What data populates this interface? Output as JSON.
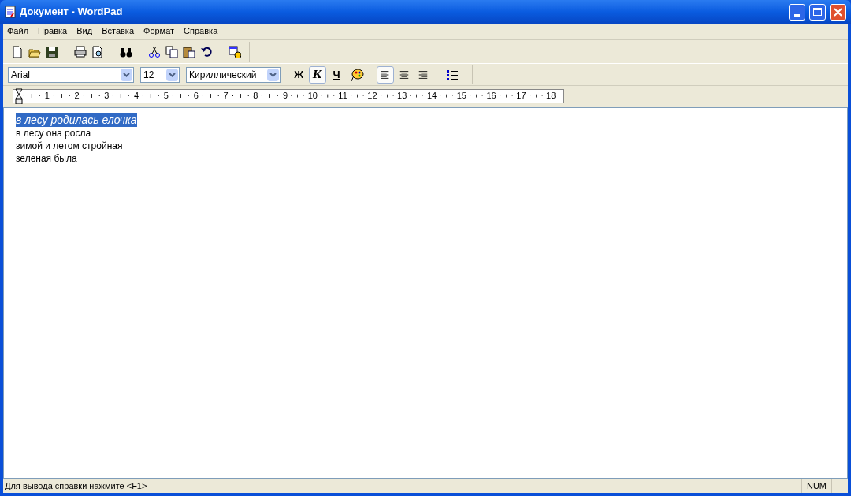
{
  "window": {
    "title": "Документ - WordPad"
  },
  "menu": [
    "Файл",
    "Правка",
    "Вид",
    "Вставка",
    "Формат",
    "Справка"
  ],
  "format_bar": {
    "font": "Arial",
    "size": "12",
    "script": "Кириллический",
    "styles": [
      {
        "kind": "bold",
        "label": "Ж",
        "selected": false
      },
      {
        "kind": "italic",
        "label": "К",
        "selected": true
      },
      {
        "kind": "underline",
        "label": "Ч",
        "selected": false
      }
    ],
    "alignment": [
      {
        "kind": "left",
        "selected": true
      },
      {
        "kind": "center",
        "selected": false
      },
      {
        "kind": "right",
        "selected": false
      }
    ]
  },
  "ruler": [
    "1",
    "2",
    "3",
    "4",
    "5",
    "6",
    "7",
    "8",
    "9",
    "10",
    "11",
    "12",
    "13",
    "14",
    "15",
    "16",
    "17",
    "18"
  ],
  "document": [
    {
      "text": "в лесу родилась елочка",
      "selected": true,
      "italic": true
    },
    {
      "text": "в лесу она росла",
      "selected": false,
      "italic": false
    },
    {
      "text": "зимой и летом стройная",
      "selected": false,
      "italic": false
    },
    {
      "text": "зеленая была",
      "selected": false,
      "italic": false
    }
  ],
  "status_bar": {
    "message": "Для вывода справки нажмите <F1>",
    "indicator": "NUM"
  }
}
